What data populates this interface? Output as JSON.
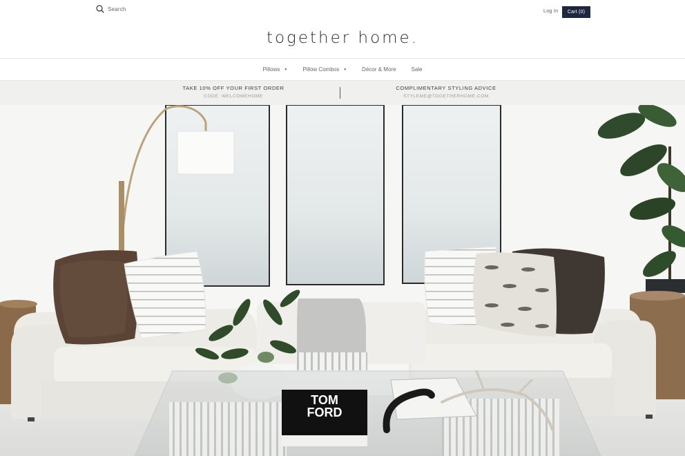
{
  "header": {
    "search_placeholder": "Search",
    "login_label": "Log In",
    "cart_label": "Cart (0)",
    "logo_text": "together home."
  },
  "nav": {
    "items": [
      {
        "label": "Pillows",
        "has_dropdown": true
      },
      {
        "label": "Pillow Combos",
        "has_dropdown": true
      },
      {
        "label": "Décor & More",
        "has_dropdown": false
      },
      {
        "label": "Sale",
        "has_dropdown": false
      }
    ]
  },
  "promo": {
    "left": {
      "heading": "TAKE 10% OFF YOUR FIRST ORDER",
      "sub": "CODE: WELCOMEHOME"
    },
    "right": {
      "heading": "COMPLIMENTARY STYLING ADVICE",
      "sub": "STYLEME@TOGETHERHOME.COM"
    }
  },
  "hero": {
    "book_title_line1": "TOM",
    "book_title_line2": "FORD"
  },
  "colors": {
    "cart_bg": "#1f2740",
    "promo_bg": "#f0f0ef",
    "sofa": "#ecebe6",
    "wall": "#f5f5f3"
  }
}
